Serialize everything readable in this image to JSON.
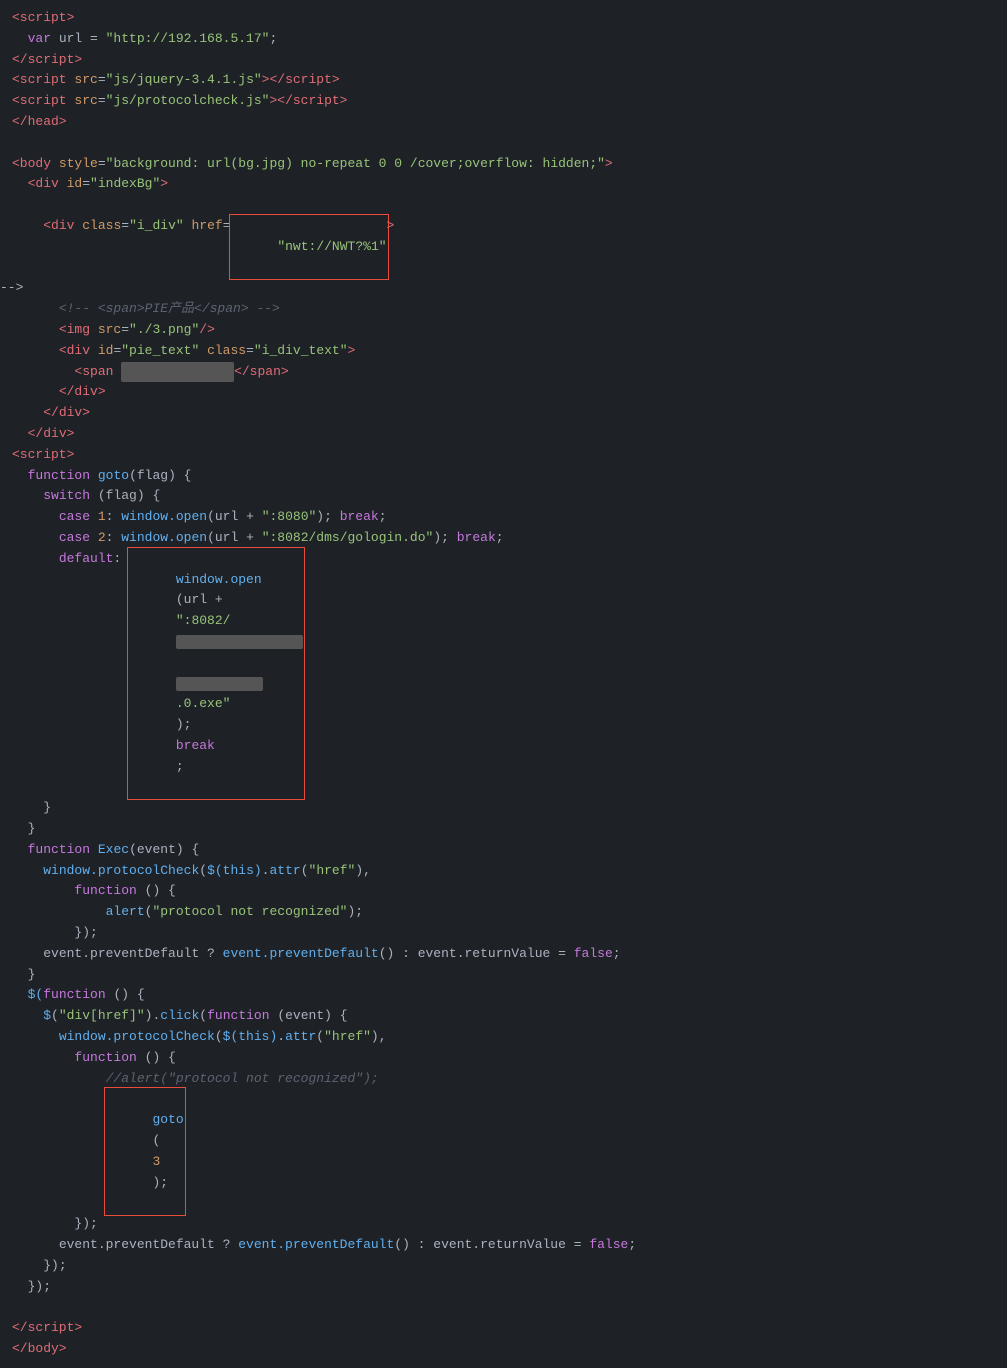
{
  "code": {
    "lines": [
      {
        "id": 1,
        "content": "script_open"
      },
      {
        "id": 2,
        "content": "var_url"
      },
      {
        "id": 3,
        "content": "script_close"
      },
      {
        "id": 4,
        "content": "script_jquery"
      },
      {
        "id": 5,
        "content": "script_protocol"
      },
      {
        "id": 6,
        "content": "head_close"
      },
      {
        "id": 7,
        "content": "blank"
      },
      {
        "id": 8,
        "content": "body_open"
      },
      {
        "id": 9,
        "content": "div_indexbg"
      },
      {
        "id": 10,
        "content": "blank"
      },
      {
        "id": 11,
        "content": "div_i_div"
      },
      {
        "id": 12,
        "content": "comment_span"
      },
      {
        "id": 13,
        "content": "img"
      },
      {
        "id": 14,
        "content": "div_pie_text"
      },
      {
        "id": 15,
        "content": "span_redacted"
      },
      {
        "id": 16,
        "content": "div_close"
      },
      {
        "id": 17,
        "content": "div_close2"
      },
      {
        "id": 18,
        "content": "div_close3"
      },
      {
        "id": 19,
        "content": "script2_open"
      },
      {
        "id": 20,
        "content": "fn_goto"
      },
      {
        "id": 21,
        "content": "switch"
      },
      {
        "id": 22,
        "content": "case1"
      },
      {
        "id": 23,
        "content": "case2"
      },
      {
        "id": 24,
        "content": "default_line"
      },
      {
        "id": 25,
        "content": "brace_close"
      },
      {
        "id": 26,
        "content": "brace_close2"
      },
      {
        "id": 27,
        "content": "fn_exec"
      },
      {
        "id": 28,
        "content": "window_protocol"
      },
      {
        "id": 29,
        "content": "fn_anon"
      },
      {
        "id": 30,
        "content": "alert"
      },
      {
        "id": 31,
        "content": "paren_close"
      },
      {
        "id": 32,
        "content": "event_prevent1"
      },
      {
        "id": 33,
        "content": "brace_close3"
      },
      {
        "id": 34,
        "content": "dollar_fn"
      },
      {
        "id": 35,
        "content": "click_fn"
      },
      {
        "id": 36,
        "content": "window_protocol2"
      },
      {
        "id": 37,
        "content": "fn_anon2"
      },
      {
        "id": 38,
        "content": "alert_comment"
      },
      {
        "id": 39,
        "content": "goto3"
      },
      {
        "id": 40,
        "content": "paren_close2"
      },
      {
        "id": 41,
        "content": "event_prevent2"
      },
      {
        "id": 42,
        "content": "paren_close3"
      },
      {
        "id": 43,
        "content": "paren_close4"
      },
      {
        "id": 44,
        "content": "blank2"
      },
      {
        "id": 45,
        "content": "script2_close"
      },
      {
        "id": 46,
        "content": "body_close"
      }
    ]
  }
}
